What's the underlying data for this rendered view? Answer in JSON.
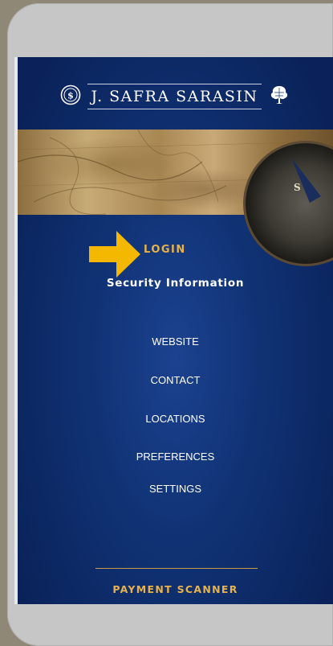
{
  "brand": {
    "name": "J. SAFRA SARASIN",
    "emblem_icon": "seal-emblem-icon",
    "tree_icon": "tree-emblem-icon"
  },
  "banner": {
    "image": "antique-map-with-compass",
    "compass_letter": "S"
  },
  "menu": {
    "login": "LOGIN",
    "security": "Security Information",
    "items": [
      {
        "label": "WEBSITE"
      },
      {
        "label": "CONTACT"
      },
      {
        "label": "LOCATIONS"
      },
      {
        "label": "PREFERENCES"
      },
      {
        "label": "SETTINGS"
      }
    ]
  },
  "footer": {
    "payment_scanner": "PAYMENT SCANNER"
  },
  "colors": {
    "background_navy": "#103274",
    "accent_gold": "#e8b24b",
    "arrow_yellow": "#f5b800",
    "text_white": "#ffffff"
  }
}
